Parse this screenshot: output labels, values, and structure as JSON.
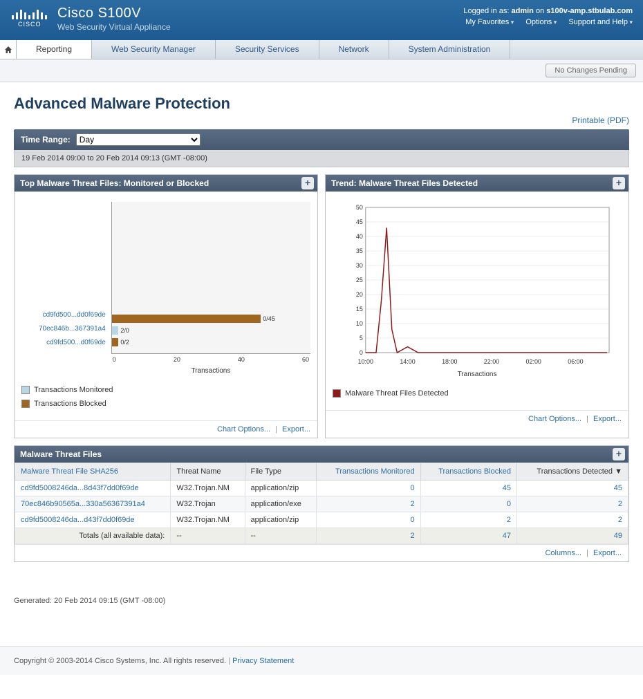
{
  "header": {
    "product": "Cisco S100V",
    "subtitle": "Web Security Virtual Appliance",
    "logged_in_prefix": "Logged in as:",
    "user": "admin",
    "on": "on",
    "host": "s100v-amp.stbulab.com",
    "links": [
      "My Favorites",
      "Options",
      "Support and Help"
    ]
  },
  "nav": {
    "items": [
      "Reporting",
      "Web Security Manager",
      "Security Services",
      "Network",
      "System Administration"
    ],
    "active": 0
  },
  "pending": "No Changes Pending",
  "page": {
    "title": "Advanced Malware Protection",
    "printable": "Printable (PDF)"
  },
  "time_range": {
    "label": "Time Range:",
    "value": "Day",
    "desc": "19 Feb 2014 09:00 to 20 Feb 2014 09:13 (GMT -08:00)"
  },
  "panel_left": {
    "title": "Top Malware Threat Files: Monitored or Blocked",
    "chart_options": "Chart Options...",
    "export": "Export...",
    "legend": {
      "monitored": "Transactions Monitored",
      "blocked": "Transactions Blocked"
    },
    "xlabel": "Transactions"
  },
  "panel_right": {
    "title": "Trend: Malware Threat Files Detected",
    "chart_options": "Chart Options...",
    "export": "Export...",
    "legend": "Malware Threat Files Detected",
    "xlabel": "Transactions"
  },
  "table": {
    "title": "Malware Threat Files",
    "headers": [
      "Malware Threat File SHA256",
      "Threat Name",
      "File Type",
      "Transactions Monitored",
      "Transactions Blocked",
      "Transactions Detected"
    ],
    "rows": [
      {
        "sha": "cd9fd5008246da...8d43f7dd0f69de",
        "name": "W32.Trojan.NM",
        "type": "application/zip",
        "mon": "0",
        "blk": "45",
        "det": "45"
      },
      {
        "sha": "70ec846b90565a...330a56367391a4",
        "name": "W32.Trojan",
        "type": "application/exe",
        "mon": "2",
        "blk": "0",
        "det": "2"
      },
      {
        "sha": "cd9fd5008246da...d43f7dd0f69de",
        "name": "W32.Trojan.NM",
        "type": "application/zip",
        "mon": "0",
        "blk": "2",
        "det": "2"
      }
    ],
    "totals": {
      "label": "Totals (all available data):",
      "c1": "--",
      "c2": "--",
      "mon": "2",
      "blk": "47",
      "det": "49"
    },
    "columns": "Columns...",
    "export": "Export..."
  },
  "generated": "Generated: 20 Feb 2014 09:15 (GMT -08:00)",
  "footer": {
    "copyright": "Copyright © 2003-2014 Cisco Systems, Inc. All rights reserved.",
    "privacy": "Privacy Statement"
  },
  "colors": {
    "monitored": "#b8d6e6",
    "blocked": "#a0651f",
    "trend": "#8f1a1a"
  },
  "chart_data": [
    {
      "type": "bar",
      "orientation": "horizontal",
      "xlabel": "Transactions",
      "xlim": [
        0,
        60
      ],
      "xticks": [
        0,
        20,
        40,
        60
      ],
      "categories": [
        "cd9fd500...dd0f69de",
        "70ec846b...367391a4",
        "cd9fd500...d0f69de"
      ],
      "series": [
        {
          "name": "Transactions Monitored",
          "values": [
            0,
            2,
            0
          ],
          "color": "#b8d6e6"
        },
        {
          "name": "Transactions Blocked",
          "values": [
            45,
            0,
            2
          ],
          "color": "#a0651f"
        }
      ],
      "bar_labels": [
        "0/45",
        "2/0",
        "0/2"
      ]
    },
    {
      "type": "line",
      "xlabel": "Transactions",
      "ylim": [
        0,
        50
      ],
      "yticks": [
        0,
        5,
        10,
        15,
        20,
        25,
        30,
        35,
        40,
        45,
        50
      ],
      "xticks": [
        "10:00",
        "14:00",
        "18:00",
        "22:00",
        "02:00",
        "06:00"
      ],
      "series": [
        {
          "name": "Malware Threat Files Detected",
          "color": "#8f1a1a",
          "x": [
            10,
            11,
            11.5,
            12,
            12.5,
            13,
            14,
            15,
            16,
            18,
            20,
            22,
            24,
            26,
            28,
            30,
            32,
            33
          ],
          "y": [
            0,
            0,
            18,
            43,
            8,
            0,
            2,
            0,
            0,
            0,
            0,
            0,
            0,
            0,
            0,
            0,
            0,
            0
          ]
        }
      ]
    }
  ]
}
